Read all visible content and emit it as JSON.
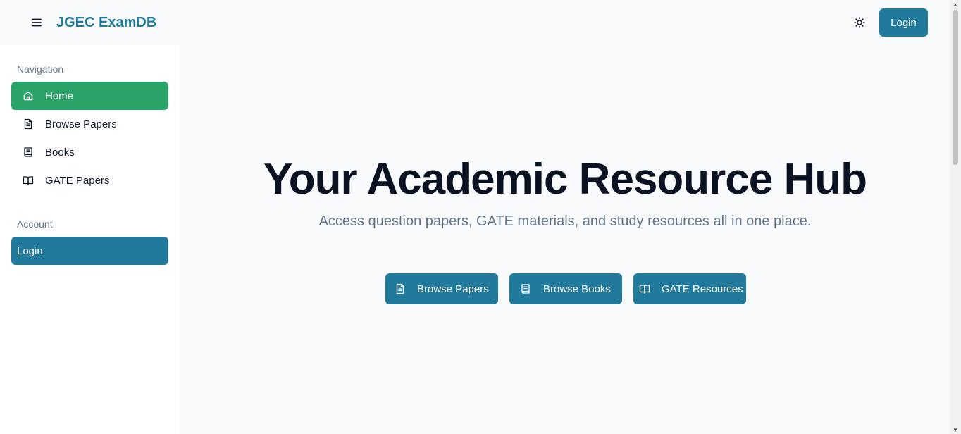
{
  "app": {
    "title": "JGEC ExamDB"
  },
  "header": {
    "login_label": "Login"
  },
  "sidebar": {
    "navigation_title": "Navigation",
    "items": [
      {
        "label": "Home",
        "icon": "home-icon"
      },
      {
        "label": "Browse Papers",
        "icon": "file-text-icon"
      },
      {
        "label": "Books",
        "icon": "book-icon"
      },
      {
        "label": "GATE Papers",
        "icon": "book-open-icon"
      }
    ],
    "account_title": "Account",
    "login_label": "Login"
  },
  "hero": {
    "title": "Your Academic Resource Hub",
    "subtitle": "Access question papers, GATE materials, and study resources all in one place.",
    "buttons": [
      {
        "label": "Browse Papers",
        "icon": "file-text-icon"
      },
      {
        "label": "Browse Books",
        "icon": "book-icon"
      },
      {
        "label": "GATE Resources",
        "icon": "book-open-icon"
      }
    ]
  },
  "colors": {
    "primary": "#217a9b",
    "active": "#2aa368",
    "muted": "#64748b"
  }
}
